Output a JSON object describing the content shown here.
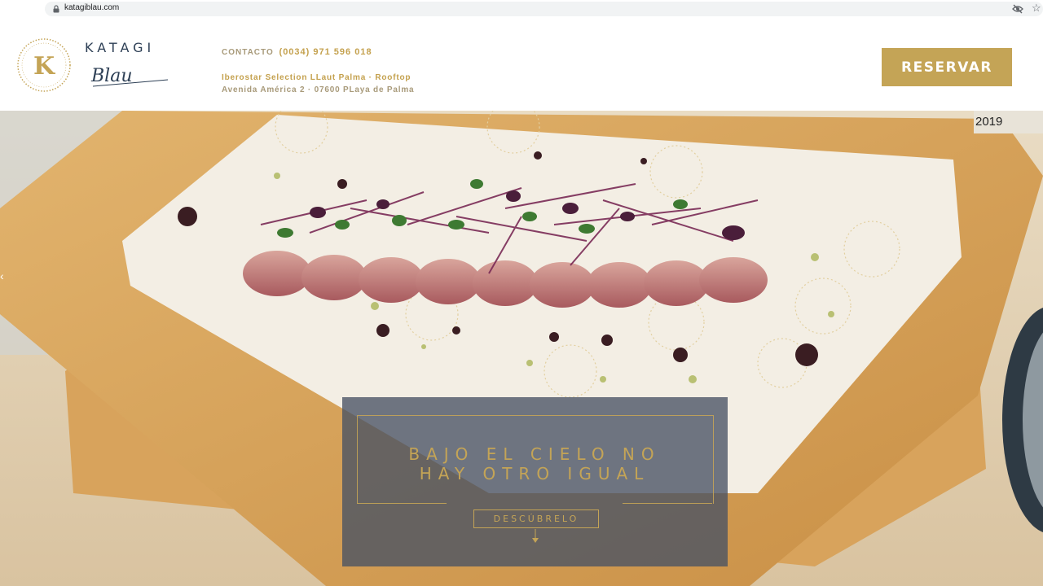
{
  "browser": {
    "url": "katagiblau.com"
  },
  "header": {
    "logo_letter": "K",
    "brand_name": "KATAGI",
    "brand_script": "Blau",
    "contact_label": "CONTACTO",
    "phone": "(0034) 971 596 018",
    "address_line1": "Iberostar Selection LLaut Palma · Rooftop",
    "address_line2": "Avenida América 2 · 07600 PLaya de Palma",
    "reserve_label": "RESERVAR"
  },
  "hero": {
    "badge_year": "2019",
    "tagline_line1": "BAJO EL CIELO NO",
    "tagline_line2": "HAY OTRO IGUAL",
    "discover_label": "DESCÚBRELO"
  },
  "colors": {
    "gold": "#c4a456",
    "navy": "#2d3f55",
    "overlay": "#485264"
  },
  "icons": [
    "lock-icon",
    "eye-off-icon",
    "star-icon",
    "chevron-left-icon",
    "arrow-down-icon"
  ]
}
